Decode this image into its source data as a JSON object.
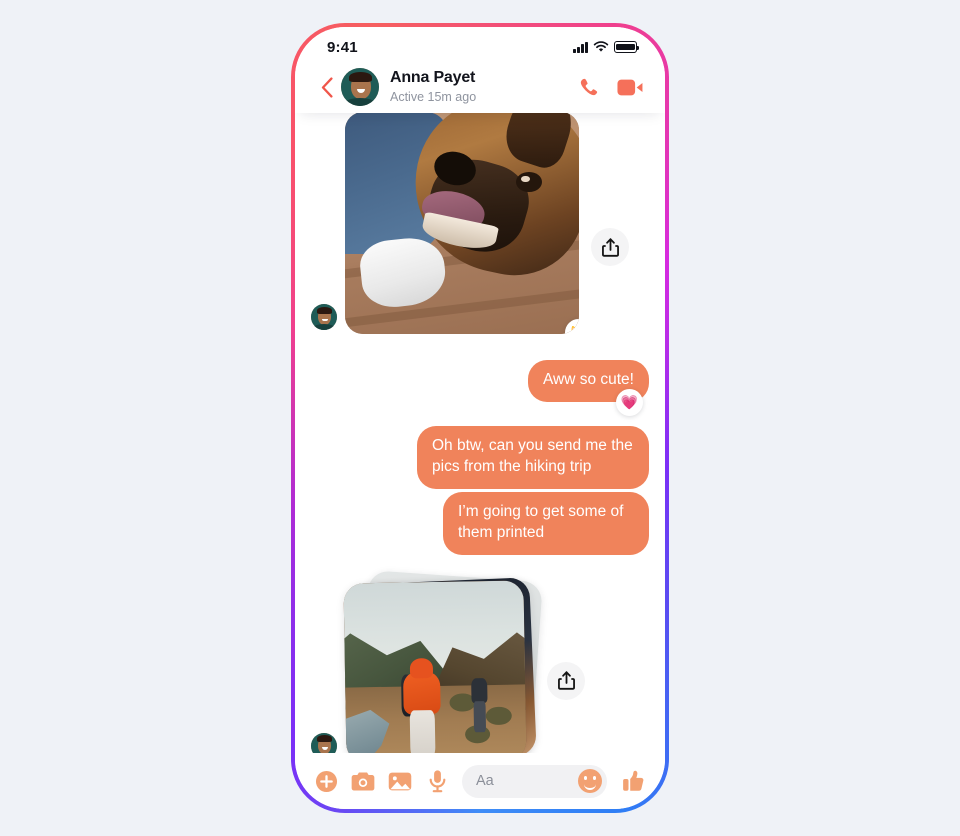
{
  "theme": {
    "page_background": "#eff2f7",
    "bubble_color": "#f08057",
    "accent_orange": "#f2a172",
    "header_action_color": "#f5705a",
    "frame_gradient": [
      "#7b2ff7",
      "#ef3f8f",
      "#f9516b",
      "#2f7ef5"
    ]
  },
  "status_bar": {
    "time": "9:41",
    "signal_icon": "cellular-signal-icon",
    "wifi_icon": "wifi-icon",
    "battery_icon": "battery-full-icon"
  },
  "header": {
    "back_icon": "chevron-left-icon",
    "avatar_name": "contact-avatar",
    "contact_name": "Anna Payet",
    "contact_status": "Active 15m ago",
    "call_icon": "phone-call-icon",
    "video_icon": "video-camera-icon"
  },
  "conversation": [
    {
      "id": "msg-photo-dog",
      "type": "image",
      "direction": "incoming",
      "media_name": "dog-photo",
      "alt": "Dog on wooden deck next to person wearing jeans and white sneakers",
      "share_icon": "share-icon",
      "reaction": "😻",
      "reaction_name": "heart-eyes-cat-reaction",
      "sender_avatar": "anna-avatar"
    },
    {
      "id": "msg-aww",
      "type": "text",
      "direction": "outgoing",
      "text": "Aww so cute!",
      "reaction": "💗",
      "reaction_name": "growing-heart-reaction"
    },
    {
      "id": "msg-btw",
      "type": "text",
      "direction": "outgoing",
      "text": "Oh btw, can you send me the pics from the hiking trip"
    },
    {
      "id": "msg-printed",
      "type": "text",
      "direction": "outgoing",
      "text": "I’m going to get some of them printed"
    },
    {
      "id": "msg-photo-stack",
      "type": "image-stack",
      "direction": "incoming",
      "media_name": "hiking-photo-stack",
      "alt": "Hiker in orange jacket with backpack walking a mountain trail beside a river",
      "share_icon": "share-icon",
      "sender_avatar": "anna-avatar",
      "stack_count": 3
    }
  ],
  "composer": {
    "add_icon": "plus-circle-icon",
    "camera_icon": "camera-icon",
    "gallery_icon": "image-gallery-icon",
    "mic_icon": "microphone-icon",
    "input_placeholder": "Aa",
    "input_value": "",
    "emoji_icon": "smiley-face-icon",
    "thumb_icon": "thumbs-up-icon"
  }
}
